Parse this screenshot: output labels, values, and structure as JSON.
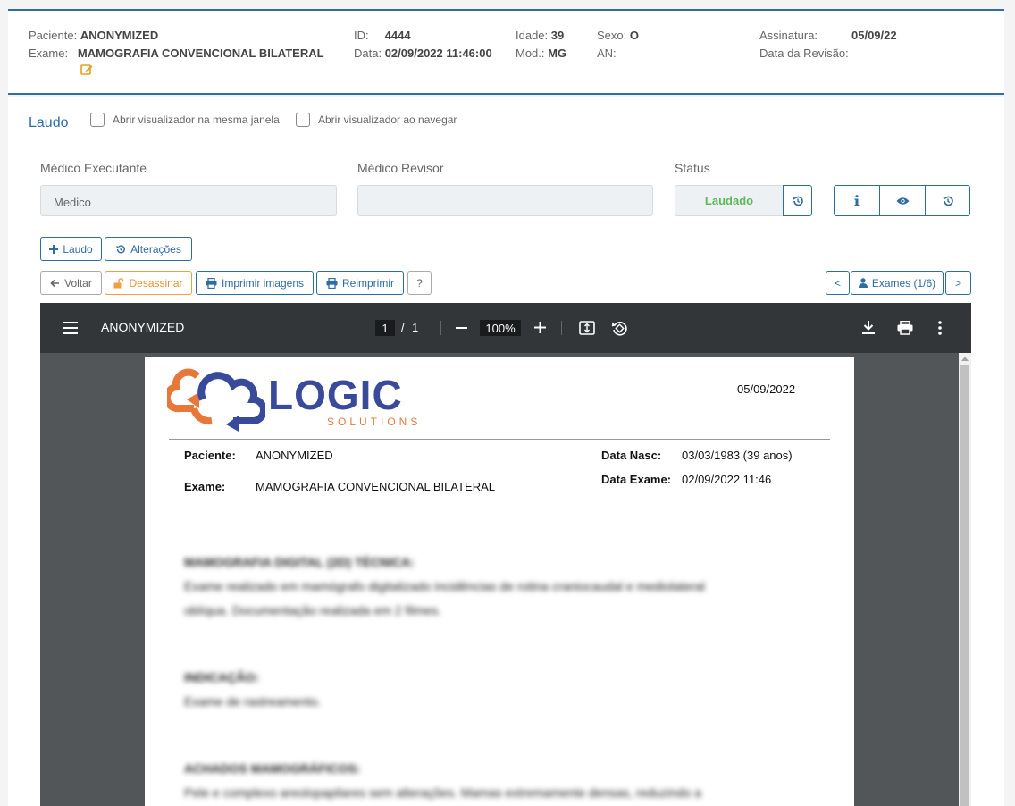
{
  "header": {
    "paciente_label": "Paciente:",
    "paciente_value": "ANONYMIZED",
    "exame_label": "Exame:",
    "exame_value": "MAMOGRAFIA CONVENCIONAL BILATERAL",
    "id_label": "ID:",
    "id_value": "4444",
    "data_label": "Data:",
    "data_value": "02/09/2022 11:46:00",
    "idade_label": "Idade:",
    "idade_value": "39",
    "mod_label": "Mod.:",
    "mod_value": "MG",
    "sexo_label": "Sexo:",
    "sexo_value": "O",
    "an_label": "AN:",
    "assinatura_label": "Assinatura:",
    "assinatura_value": "05/09/22",
    "revisao_label": "Data da Revisão:"
  },
  "laudo": {
    "title": "Laudo",
    "chk_same_window": "Abrir visualizador na mesma janela",
    "chk_on_navigate": "Abrir visualizador ao navegar",
    "medico_executante_label": "Médico Executante",
    "medico_executante_value": "Medico",
    "medico_revisor_label": "Médico Revisor",
    "status_label": "Status",
    "status_value": "Laudado",
    "status_color": "#5cb85c"
  },
  "buttons": {
    "add_laudo": "Laudo",
    "alteracoes": "Alterações",
    "voltar": "Voltar",
    "desassinar": "Desassinar",
    "imprimir_imagens": "Imprimir imagens",
    "reimprimir": "Reimprimir",
    "help": "?",
    "prev": "<",
    "exames": "Exames (1/6)",
    "next": ">"
  },
  "pdf": {
    "title": "ANONYMIZED",
    "page_current": "1",
    "page_sep": "/",
    "page_total": "1",
    "zoom": "100%"
  },
  "report": {
    "logo_main": "LOGIC",
    "logo_sub": "SOLUTIONS",
    "date": "05/09/2022",
    "paciente_label": "Paciente:",
    "paciente_value": "ANONYMIZED",
    "exame_label": "Exame:",
    "exame_value": "MAMOGRAFIA CONVENCIONAL BILATERAL",
    "nasc_label": "Data Nasc:",
    "nasc_value": "03/03/1983 (39 anos)",
    "data_exame_label": "Data Exame:",
    "data_exame_value": "02/09/2022 11:46",
    "sec1_title": "MAMOGRAFIA DIGITAL (2D) TÉCNICA:",
    "sec1_line1": "Exame realizado em mamógrafo digitalizado incidências de rotina craniocaudal e mediolateral",
    "sec1_line2": "oblíqua. Documentação realizada em 2 filmes.",
    "sec2_title": "INDICAÇÃO:",
    "sec2_line1": "Exame de rastreamento.",
    "sec3_title": "ACHADOS MAMOGRÁFICOS:",
    "sec3_line1": "Pele e complexo areolopapilares sem alterações. Mamas extremamente densas, reduzindo a"
  }
}
